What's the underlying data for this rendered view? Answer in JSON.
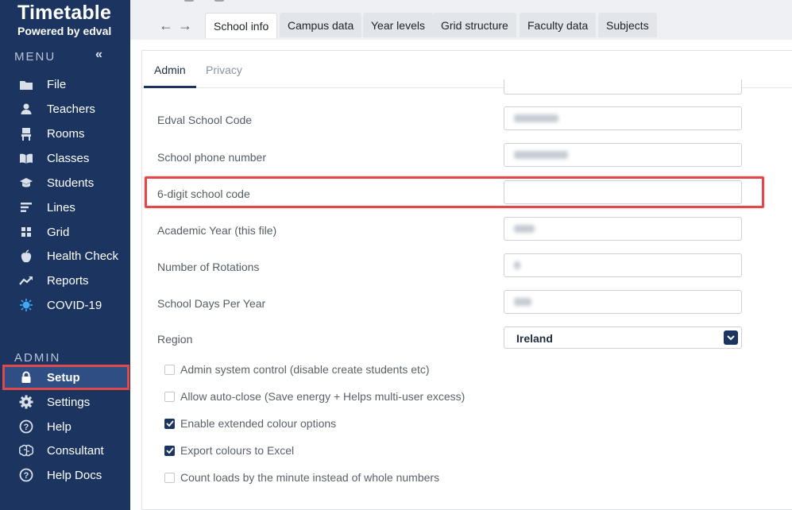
{
  "app": {
    "title": "Timetable",
    "subtitle": "Powered by edval"
  },
  "sidebar": {
    "menu_label": "MENU",
    "collapse_glyph": "«",
    "menu_items": [
      {
        "label": "File",
        "icon": "folder-icon"
      },
      {
        "label": "Teachers",
        "icon": "person-icon"
      },
      {
        "label": "Rooms",
        "icon": "chair-icon"
      },
      {
        "label": "Classes",
        "icon": "book-icon"
      },
      {
        "label": "Students",
        "icon": "graduation-cap-icon"
      },
      {
        "label": "Lines",
        "icon": "lines-icon"
      },
      {
        "label": "Grid",
        "icon": "grid-icon"
      },
      {
        "label": "Health Check",
        "icon": "apple-icon"
      },
      {
        "label": "Reports",
        "icon": "trend-icon"
      },
      {
        "label": "COVID-19",
        "icon": "virus-icon"
      }
    ],
    "admin_label": "ADMIN",
    "admin_items": [
      {
        "label": "Setup",
        "icon": "lock-icon",
        "active": true
      },
      {
        "label": "Settings",
        "icon": "gear-icon"
      },
      {
        "label": "Help",
        "icon": "question-icon"
      },
      {
        "label": "Consultant",
        "icon": "brain-icon"
      },
      {
        "label": "Help Docs",
        "icon": "question-icon"
      }
    ]
  },
  "nav": {
    "back": "←",
    "forward": "→"
  },
  "tabs": [
    {
      "label": "School info",
      "active": true
    },
    {
      "label": "Campus data"
    },
    {
      "label": "Year levels"
    },
    {
      "label": "Grid structure"
    },
    {
      "label": "Faculty data"
    },
    {
      "label": "Subjects"
    }
  ],
  "subtabs": [
    {
      "label": "Admin",
      "active": true
    },
    {
      "label": "Privacy"
    }
  ],
  "fields": [
    {
      "label": "Edval School Code",
      "value": ""
    },
    {
      "label": "School phone number",
      "value": ""
    },
    {
      "label": "6-digit school code",
      "value": ""
    },
    {
      "label": "Academic Year (this file)",
      "value": ""
    },
    {
      "label": "Number of Rotations",
      "value": ""
    },
    {
      "label": "School Days Per Year",
      "value": ""
    }
  ],
  "region": {
    "label": "Region",
    "value": "Ireland"
  },
  "checkboxes": [
    {
      "label": "Admin system control (disable create students etc)",
      "checked": false
    },
    {
      "label": "Allow auto-close (Save energy + Helps multi-user excess)",
      "checked": false
    },
    {
      "label": "Enable extended colour options",
      "checked": true
    },
    {
      "label": "Export colours to Excel",
      "checked": true
    },
    {
      "label": "Count loads by the minute instead of whole numbers",
      "checked": false
    }
  ],
  "colors": {
    "sidebar": "#1b3560",
    "highlight": "#e0494b",
    "accent": "#1b3560"
  }
}
